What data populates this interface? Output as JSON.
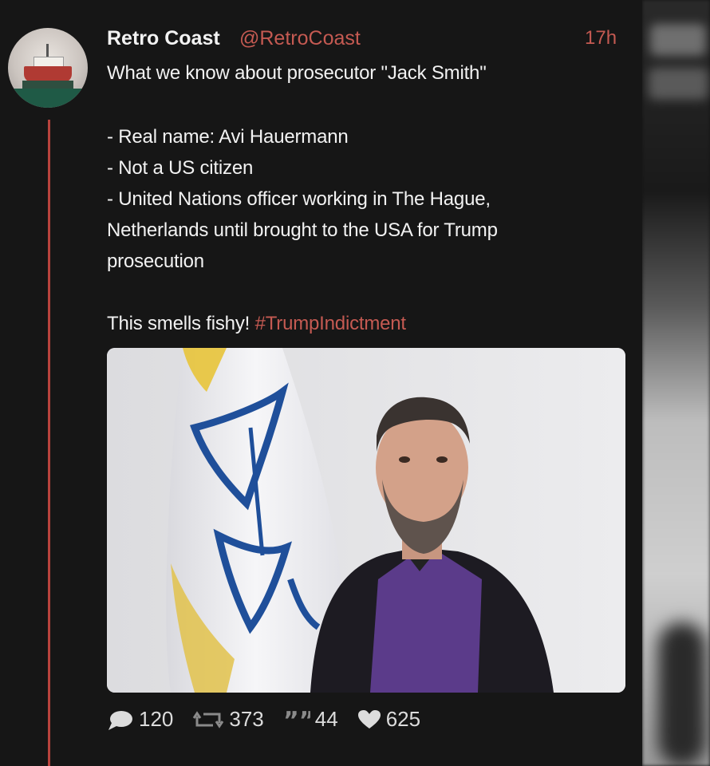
{
  "post": {
    "author_name": "Retro Coast",
    "author_handle": "@RetroCoast",
    "time_ago": "17h",
    "lines": [
      "What we know about prosecutor \"Jack Smith\"",
      "- Real name: Avi Hauermann",
      "- Not a US citizen",
      "- United Nations officer working in The Hague,",
      "Netherlands until brought to the USA for Trump",
      "prosecution"
    ],
    "closing_text": "This smells fishy! ",
    "hashtag": "#TrumpIndictment",
    "accent_color": "#c55a52"
  },
  "actions": {
    "replies": "120",
    "reposts": "373",
    "quotes": "44",
    "likes": "625"
  },
  "icons": {
    "avatar": "ship-avatar",
    "reply": "speech-bubble-icon",
    "repost": "repost-arrows-icon",
    "quote": "quote-icon",
    "like": "heart-icon"
  }
}
